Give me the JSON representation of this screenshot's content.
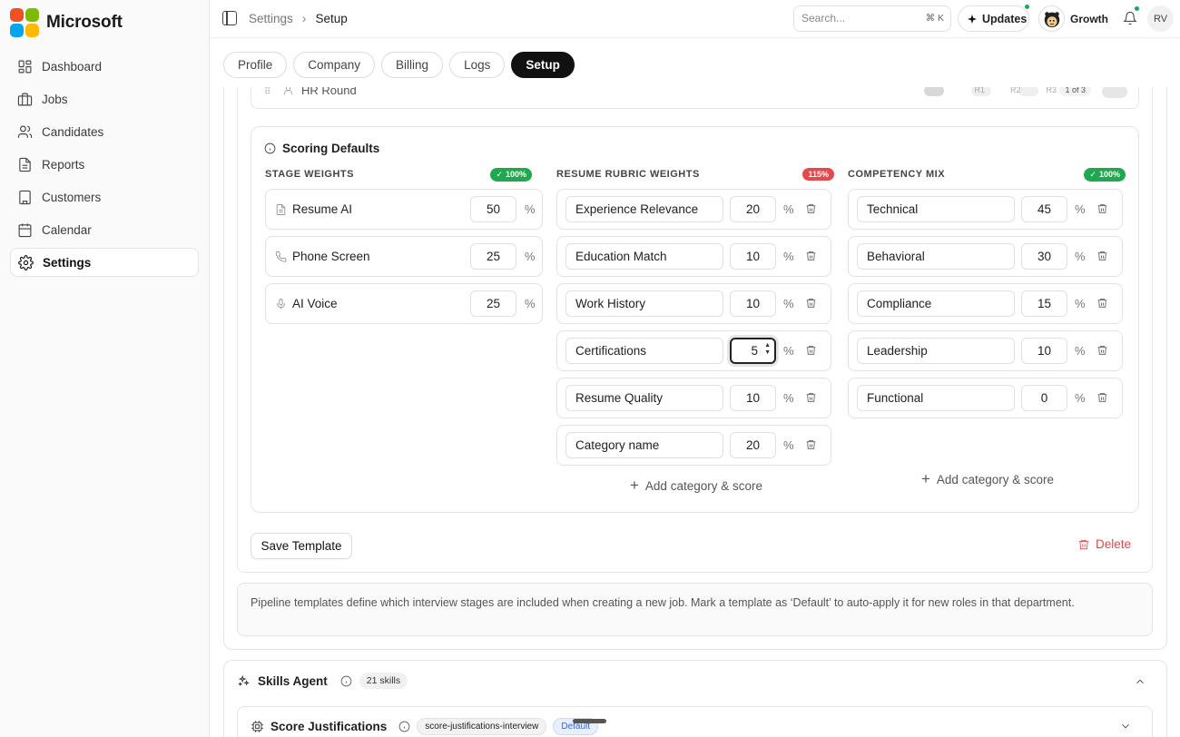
{
  "brand": {
    "name": "Microsoft",
    "logo_colors": [
      "#f25022",
      "#7fba00",
      "#00a4ef",
      "#ffb900"
    ]
  },
  "sidebar": {
    "items": [
      {
        "label": "Dashboard",
        "icon": "dashboard-icon"
      },
      {
        "label": "Jobs",
        "icon": "briefcase-icon"
      },
      {
        "label": "Candidates",
        "icon": "users-icon"
      },
      {
        "label": "Reports",
        "icon": "file-icon"
      },
      {
        "label": "Customers",
        "icon": "building-icon"
      },
      {
        "label": "Calendar",
        "icon": "calendar-icon"
      },
      {
        "label": "Settings",
        "icon": "gear-icon",
        "active": true
      }
    ]
  },
  "topbar": {
    "breadcrumb": [
      "Settings",
      "Setup"
    ],
    "search_placeholder": "Search...",
    "search_shortcut": "⌘ K",
    "updates_label": "Updates",
    "workspace_label": "Growth",
    "user_initials": "RV"
  },
  "tabs": [
    {
      "label": "Profile"
    },
    {
      "label": "Company"
    },
    {
      "label": "Billing"
    },
    {
      "label": "Logs"
    },
    {
      "label": "Setup",
      "active": true
    }
  ],
  "hr_round": {
    "label": "HR Round",
    "rounds": [
      "R1",
      "R2",
      "R3"
    ],
    "counter": "1 of 3"
  },
  "scoring": {
    "title": "Scoring Defaults",
    "stage_weights": {
      "heading": "STAGE WEIGHTS",
      "badge": "100%",
      "badge_status": "ok",
      "rows": [
        {
          "label": "Resume AI",
          "value": "50",
          "icon": "document-icon"
        },
        {
          "label": "Phone Screen",
          "value": "25",
          "icon": "phone-icon"
        },
        {
          "label": "AI Voice",
          "value": "25",
          "icon": "mic-icon"
        }
      ]
    },
    "resume_rubric": {
      "heading": "RESUME RUBRIC WEIGHTS",
      "badge": "115%",
      "badge_status": "error",
      "rows": [
        {
          "label": "Experience Relevance",
          "value": "20"
        },
        {
          "label": "Education Match",
          "value": "10"
        },
        {
          "label": "Work History",
          "value": "10"
        },
        {
          "label": "Certifications",
          "value": "5",
          "focused": true
        },
        {
          "label": "Resume Quality",
          "value": "10"
        },
        {
          "label": "Category name",
          "value": "20"
        }
      ],
      "add_label": "Add category & score"
    },
    "competency_mix": {
      "heading": "COMPETENCY MIX",
      "badge": "100%",
      "badge_status": "ok",
      "rows": [
        {
          "label": "Technical",
          "value": "45"
        },
        {
          "label": "Behavioral",
          "value": "30"
        },
        {
          "label": "Compliance",
          "value": "15"
        },
        {
          "label": "Leadership",
          "value": "10"
        },
        {
          "label": "Functional",
          "value": "0"
        }
      ],
      "add_label": "Add category & score"
    },
    "percent_symbol": "%"
  },
  "actions": {
    "save_label": "Save Template",
    "delete_label": "Delete"
  },
  "note": "Pipeline templates define which interview stages are included when creating a new job. Mark a template as ‘Default’ to auto-apply it for new roles in that department.",
  "skills_agent": {
    "title": "Skills Agent",
    "count_label": "21 skills"
  },
  "score_justifications": {
    "title": "Score Justifications",
    "slug": "score-justifications-interview",
    "default_label": "Default"
  },
  "colors": {
    "accent_dark": "#111111",
    "success": "#1fa84f",
    "error": "#e5484d"
  }
}
